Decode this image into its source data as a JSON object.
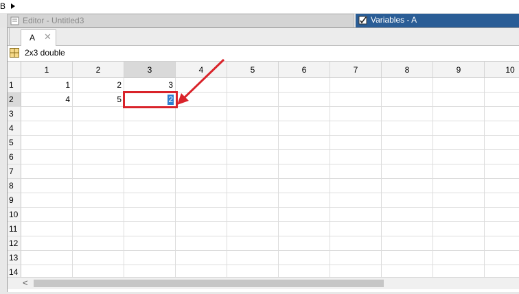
{
  "topbar": {
    "breadcrumb": "B"
  },
  "window_tabs": {
    "editor": "Editor - Untitled3",
    "variables": "Variables - A"
  },
  "doc_tab": {
    "label": "A",
    "close": "✕"
  },
  "variable_info": "2x3 double",
  "grid": {
    "columns": [
      "1",
      "2",
      "3",
      "4",
      "5",
      "6",
      "7",
      "8",
      "9",
      "10"
    ],
    "rows": [
      "1",
      "2",
      "3",
      "4",
      "5",
      "6",
      "7",
      "8",
      "9",
      "10",
      "11",
      "12",
      "13",
      "14"
    ],
    "cells": {
      "r1": [
        "1",
        "2",
        "3"
      ],
      "r2": [
        "4",
        "5"
      ]
    },
    "editing_value": "2",
    "selected_column": "3",
    "selected_row": "2"
  },
  "scrollbar": {
    "left_arrow": "<"
  },
  "colors": {
    "accent": "#2a5d96",
    "highlight": "#d9232a",
    "selection": "#2f7fd0"
  }
}
